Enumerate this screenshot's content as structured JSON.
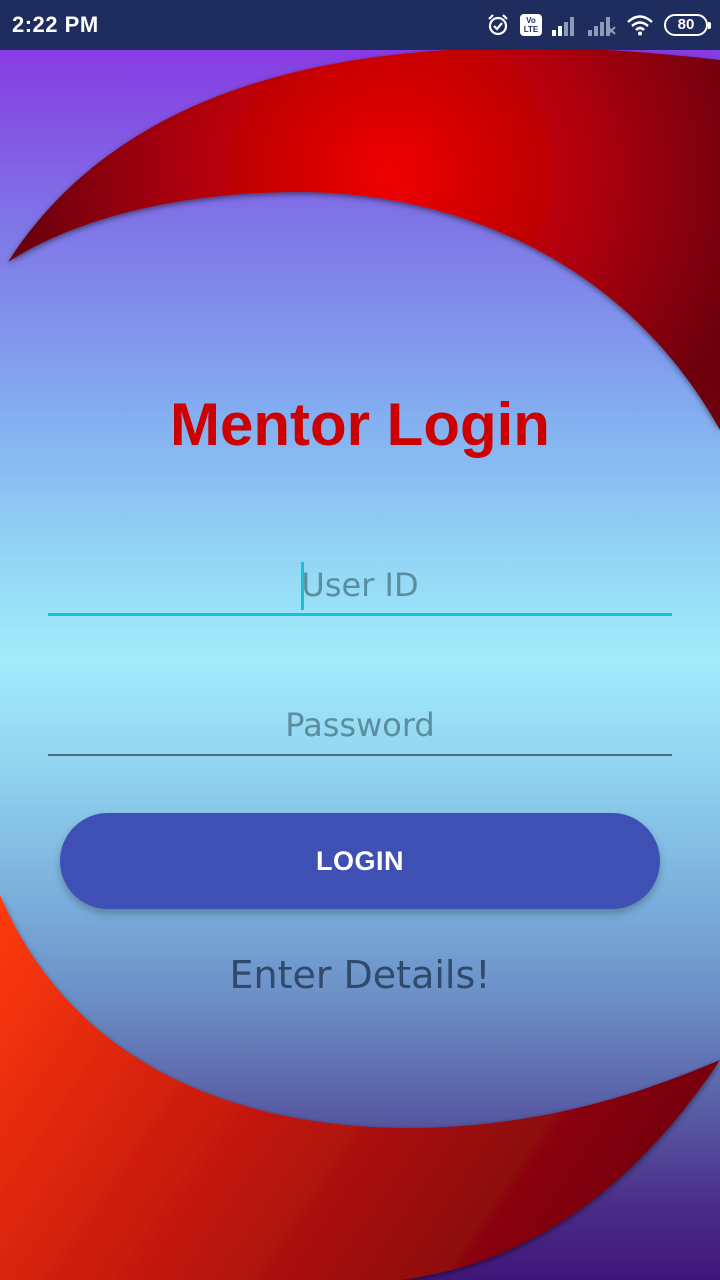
{
  "status_bar": {
    "time": "2:22 PM",
    "volte_label": "Vo LTE",
    "battery_level": "80",
    "icons": [
      "alarm-icon",
      "volte-icon",
      "signal-icon",
      "signal-no-service-icon",
      "wifi-icon",
      "battery-icon"
    ]
  },
  "login": {
    "title": "Mentor Login",
    "user_id_placeholder": "User ID",
    "user_id_value": "",
    "password_placeholder": "Password",
    "password_value": "",
    "button_label": "LOGIN",
    "status_message": "Enter Details!"
  },
  "colors": {
    "title": "#cc0000",
    "button": "#3e50b4",
    "status_bar": "#1f2d5e",
    "focus_underline": "#19c0d6",
    "arc_red": "#e60000"
  }
}
